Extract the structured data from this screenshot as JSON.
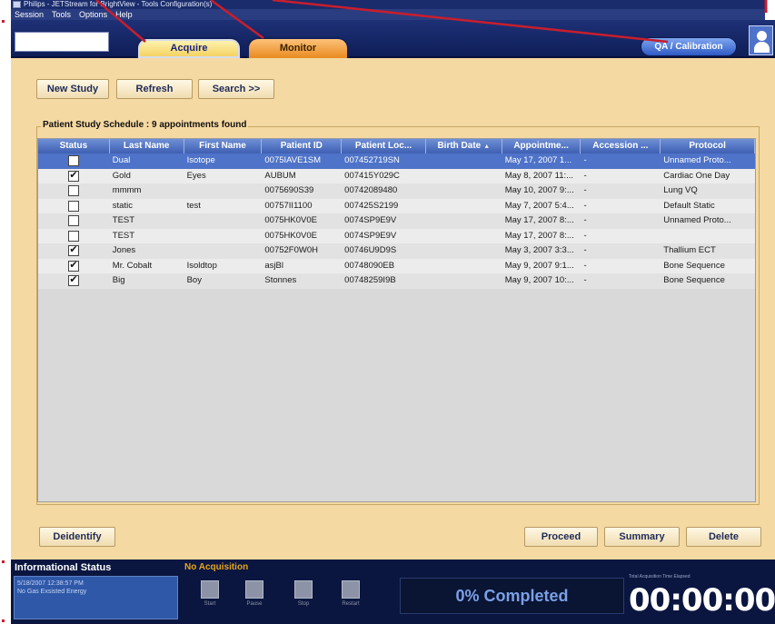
{
  "window": {
    "title": "Philips - JETStream for BrightView - Tools Configuration(s)",
    "menu": [
      "Session",
      "Tools",
      "Options",
      "Help"
    ]
  },
  "nav": {
    "tabs": [
      {
        "label": "Acquire"
      },
      {
        "label": "Monitor"
      }
    ],
    "qa_label": "QA / Calibration"
  },
  "toolbar": {
    "new_study": "New Study",
    "refresh": "Refresh",
    "search": "Search >>"
  },
  "schedule": {
    "title": "Patient Study Schedule : 9 appointments found",
    "columns": [
      "Status",
      "Last Name",
      "First Name",
      "Patient ID",
      "Patient Loc...",
      "Birth Date",
      "Appointme...",
      "Accession ...",
      "Protocol"
    ],
    "rows": [
      {
        "checked": false,
        "selected": true,
        "last": "Dual",
        "first": "Isotope",
        "pid": "0075IAVE1SM",
        "ploc": "007452719SN",
        "birth": "",
        "appt": "May 17, 2007 1...",
        "acc": "-",
        "protocol": "Unnamed Proto..."
      },
      {
        "checked": true,
        "selected": false,
        "last": "Gold",
        "first": "Eyes",
        "pid": "AUBUM",
        "ploc": "007415Y029C",
        "birth": "",
        "appt": "May 8, 2007 11:...",
        "acc": "-",
        "protocol": "Cardiac One Day"
      },
      {
        "checked": false,
        "selected": false,
        "last": "mmmm",
        "first": "",
        "pid": "0075690S39",
        "ploc": "00742089480",
        "birth": "",
        "appt": "May 10, 2007 9:...",
        "acc": "-",
        "protocol": "Lung VQ"
      },
      {
        "checked": false,
        "selected": false,
        "last": "static",
        "first": "test",
        "pid": "00757II1100",
        "ploc": "007425S2199",
        "birth": "",
        "appt": "May 7, 2007 5:4...",
        "acc": "-",
        "protocol": "Default Static"
      },
      {
        "checked": false,
        "selected": false,
        "last": "TEST",
        "first": "",
        "pid": "0075HK0V0E",
        "ploc": "0074SP9E9V",
        "birth": "",
        "appt": "May 17, 2007 8:...",
        "acc": "-",
        "protocol": "Unnamed Proto..."
      },
      {
        "checked": false,
        "selected": false,
        "last": "TEST",
        "first": "",
        "pid": "0075HK0V0E",
        "ploc": "0074SP9E9V",
        "birth": "",
        "appt": "May 17, 2007 8:...",
        "acc": "-",
        "protocol": ""
      },
      {
        "checked": true,
        "selected": false,
        "last": "Jones",
        "first": "",
        "pid": "00752F0W0H",
        "ploc": "00746U9D9S",
        "birth": "",
        "appt": "May 3, 2007 3:3...",
        "acc": "-",
        "protocol": "Thallium ECT"
      },
      {
        "checked": true,
        "selected": false,
        "last": "Mr. Cobalt",
        "first": "Isoldtop",
        "pid": "asjBl",
        "ploc": "00748090EB",
        "birth": "",
        "appt": "May 9, 2007 9:1...",
        "acc": "-",
        "protocol": "Bone Sequence"
      },
      {
        "checked": true,
        "selected": false,
        "last": "Big",
        "first": "Boy",
        "pid": "Stonnes",
        "ploc": "00748259I9B",
        "birth": "",
        "appt": "May 9, 2007 10:...",
        "acc": "-",
        "protocol": "Bone Sequence"
      }
    ]
  },
  "footer_buttons": {
    "deidentify": "Deidentify",
    "proceed": "Proceed",
    "summary": "Summary",
    "delete": "Delete"
  },
  "status": {
    "title": "Informational Status",
    "lines": [
      "5/18/2007 12:38:57 PM",
      "No Gas Exsisted Energy"
    ],
    "acquisition": "No Acquisition",
    "controls": [
      "Start",
      "Pause",
      "Stop",
      "Restart"
    ],
    "progress_text": "0% Completed",
    "timer_label": "Total Acquisition Time Elapsed",
    "timer": "00:00:00"
  },
  "colors": {
    "panel": "#f5d9a2",
    "nav": "#1e3176",
    "selected_row": "#4e73c9",
    "annotation": "#c81e2d"
  }
}
